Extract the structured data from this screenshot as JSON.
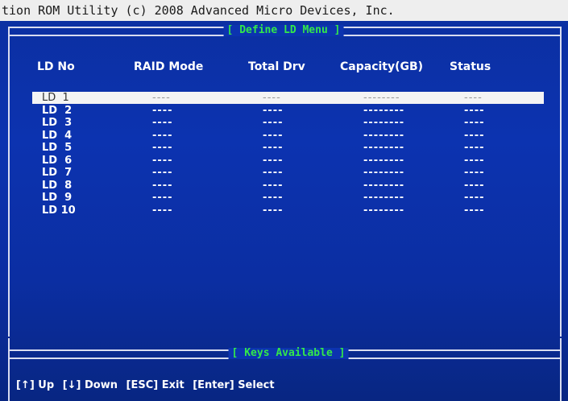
{
  "title_bar": "tion ROM Utility (c) 2008 Advanced Micro Devices, Inc.",
  "menu_caption": "[ Define LD Menu ]",
  "columns": [
    "LD No",
    "RAID Mode",
    "Total Drv",
    "Capacity(GB)",
    "Status"
  ],
  "rows": [
    {
      "ld": "LD  1",
      "raid": "----",
      "drv": "----",
      "cap": "--------",
      "status": "----",
      "selected": true
    },
    {
      "ld": "LD  2",
      "raid": "----",
      "drv": "----",
      "cap": "--------",
      "status": "----"
    },
    {
      "ld": "LD  3",
      "raid": "----",
      "drv": "----",
      "cap": "--------",
      "status": "----"
    },
    {
      "ld": "LD  4",
      "raid": "----",
      "drv": "----",
      "cap": "--------",
      "status": "----"
    },
    {
      "ld": "LD  5",
      "raid": "----",
      "drv": "----",
      "cap": "--------",
      "status": "----"
    },
    {
      "ld": "LD  6",
      "raid": "----",
      "drv": "----",
      "cap": "--------",
      "status": "----"
    },
    {
      "ld": "LD  7",
      "raid": "----",
      "drv": "----",
      "cap": "--------",
      "status": "----"
    },
    {
      "ld": "LD  8",
      "raid": "----",
      "drv": "----",
      "cap": "--------",
      "status": "----"
    },
    {
      "ld": "LD  9",
      "raid": "----",
      "drv": "----",
      "cap": "--------",
      "status": "----"
    },
    {
      "ld": "LD 10",
      "raid": "----",
      "drv": "----",
      "cap": "--------",
      "status": "----"
    }
  ],
  "keys_caption": "[ Keys Available ]",
  "keys": [
    "[↑] Up",
    "[↓] Down",
    "[ESC] Exit",
    "[Enter] Select"
  ],
  "colors": {
    "background": "#0c33b0",
    "caption": "#33e84a",
    "text": "#ffffff",
    "highlight": "#f4f4f4"
  }
}
